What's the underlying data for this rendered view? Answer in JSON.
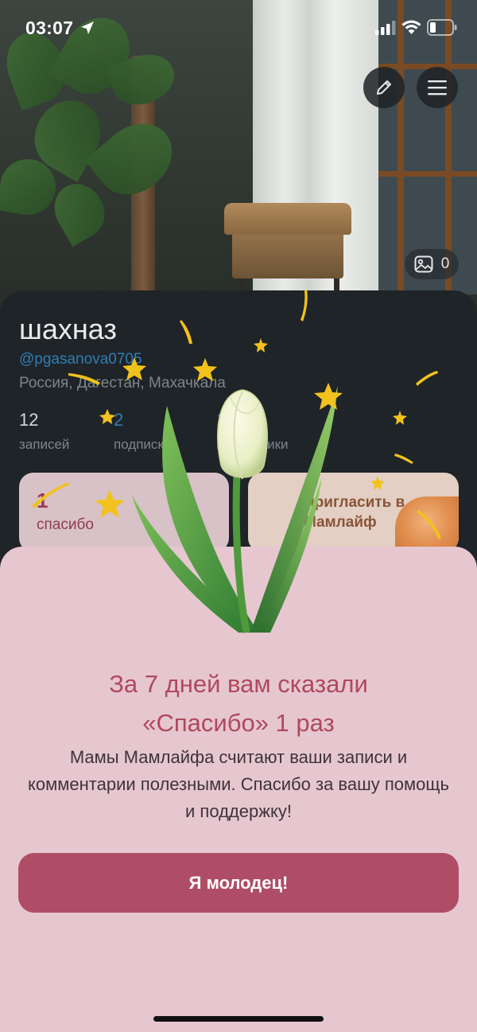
{
  "status_bar": {
    "time": "03:07"
  },
  "profile": {
    "photo_count": "0",
    "name": "шахназ",
    "handle": "@pgasanova0705",
    "location": "Россия, Дагестан, Махачкала",
    "stats": [
      {
        "value": "12",
        "label": "записей"
      },
      {
        "value": "2",
        "label": "подписки"
      },
      {
        "value": "1",
        "label": "подписчики"
      }
    ],
    "thanks_card": {
      "count": "1",
      "label": "спасибо"
    },
    "invite_card": {
      "label": "Пригласить в Мамлайф"
    }
  },
  "sheet": {
    "title_line1": "За 7 дней вам сказали",
    "title_line2": "«Спасибо» 1 раз",
    "text": "Мамы Мамлайфа считают ваши записи и комментарии полезными. Спасибо за вашу помощь и поддержку!",
    "button_label": "Я молодец!"
  },
  "colors": {
    "accent": "#b04d66",
    "sheet_bg": "#e6c7d0",
    "title": "#b0485e",
    "link": "#2e7fb4",
    "card_bg": "#1f2429"
  },
  "icons": [
    "location-arrow-icon",
    "signal-icon",
    "wifi-icon",
    "battery-icon",
    "pencil-icon",
    "menu-icon",
    "image-icon",
    "tulip-illustration",
    "star-icon"
  ]
}
